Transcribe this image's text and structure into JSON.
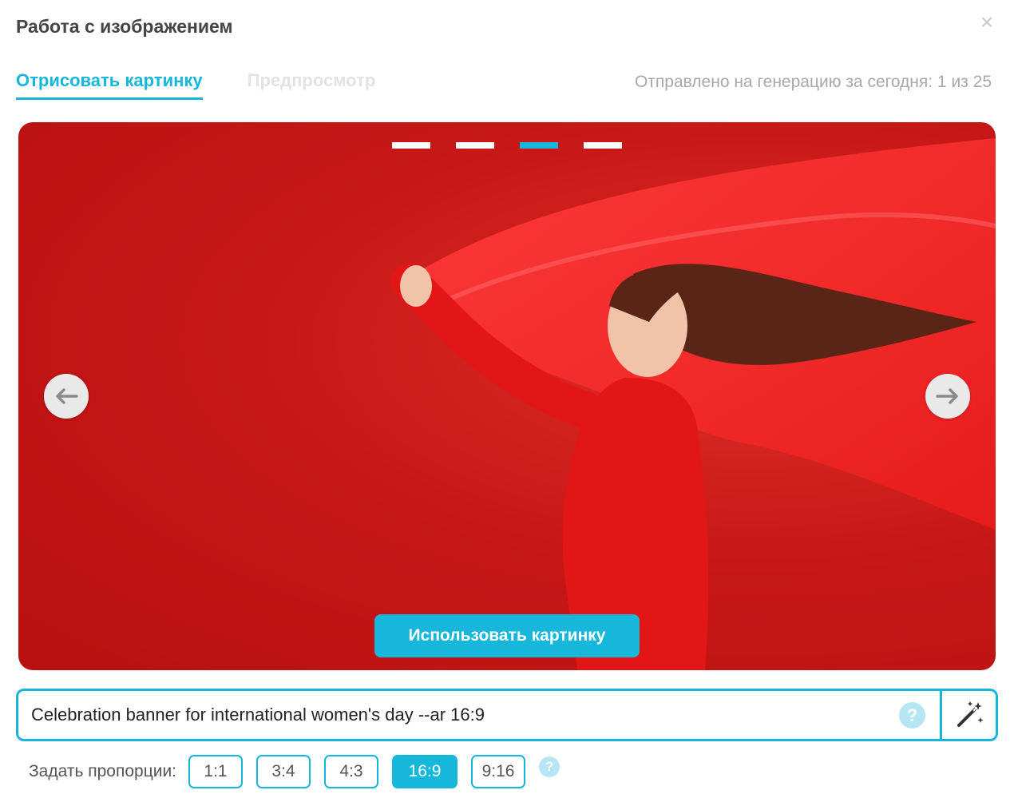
{
  "dialog": {
    "title": "Работа с изображением",
    "close_icon": "close-icon"
  },
  "tabs": [
    {
      "label": "Отрисовать картинку",
      "active": true
    },
    {
      "label": "Предпросмотр",
      "active": false
    }
  ],
  "generation_counter": "Отправлено на генерацию за сегодня: 1 из 25",
  "carousel": {
    "slides_count": 4,
    "active_slide": 3,
    "prev_icon": "arrow-left-icon",
    "next_icon": "arrow-right-icon",
    "use_button_label": "Использовать картинку"
  },
  "prompt": {
    "value": "Celebration banner for international women's day --ar 16:9",
    "help_icon": "question-icon",
    "magic_icon": "magic-wand-icon"
  },
  "proportions": {
    "label": "Задать пропорции:",
    "options": [
      "1:1",
      "3:4",
      "4:3",
      "16:9",
      "9:16"
    ],
    "selected": "16:9"
  },
  "colors": {
    "accent": "#17b7dc",
    "image_background": "#c81818"
  }
}
